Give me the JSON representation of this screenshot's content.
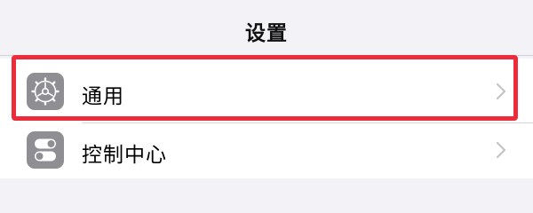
{
  "header": {
    "title": "设置"
  },
  "settings": {
    "items": [
      {
        "label": "通用",
        "icon": "gear-icon",
        "chevron": "chevron-right-icon",
        "highlighted": true
      },
      {
        "label": "控制中心",
        "icon": "toggle-switches-icon",
        "chevron": "chevron-right-icon",
        "highlighted": false
      }
    ]
  },
  "colors": {
    "background": "#f2f2f7",
    "icon_gray": "#8e8e93",
    "highlight_red": "#ee2b3b"
  }
}
